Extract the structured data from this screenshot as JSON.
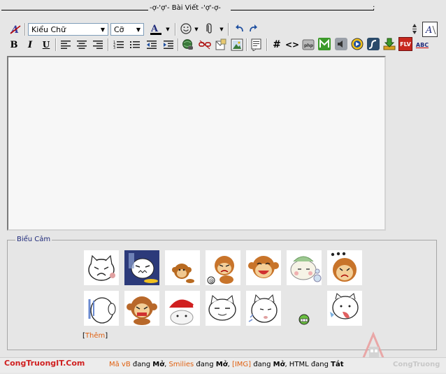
{
  "title": {
    "text": "-ợ-'ợ'- Bài Viết -'ợ'-ợ-",
    "semicolon": ";"
  },
  "toolbar": {
    "font_select": "Kiểu Chữ",
    "size_select": "Cỡ",
    "bold": "B",
    "italic": "I",
    "underline": "U",
    "hash": "#",
    "code": "<>",
    "flv": "FLV",
    "abc": "ABC"
  },
  "smilies": {
    "legend": "Biểu Cảm",
    "more_open": "[",
    "more_label": "Thêm",
    "more_close": "]"
  },
  "footer": {
    "brand": "CongTruongIT.Com",
    "vb_label": "Mã vB",
    "vb_mid": " đang ",
    "vb_state": "Mở",
    "sep1": ", ",
    "smilies_label": "Smilies",
    "smilies_mid": " đang ",
    "smilies_state": "Mở",
    "sep2": ", ",
    "img_label": "[IMG]",
    "img_mid": " đang ",
    "img_state": "Mở",
    "sep3": ", HTML đang ",
    "html_state": "Tắt"
  },
  "watermark": {
    "text": "CongTruong"
  },
  "colors": {
    "accent": "#e06010",
    "brand": "#d02020",
    "legend": "#1f2a7a"
  }
}
